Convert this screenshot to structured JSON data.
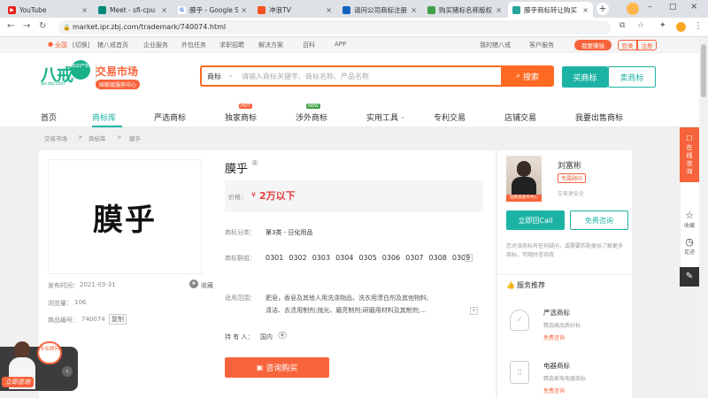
{
  "browser": {
    "tabs": [
      {
        "title": "YouTube",
        "favicon_color": "#e62117",
        "glyph": "▶"
      },
      {
        "title": "Meet - sfi-cpu",
        "favicon_color": "#00897b",
        "glyph": "●"
      },
      {
        "title": "膜乎 - Google Se",
        "favicon_color": "#4285f4",
        "glyph": "G"
      },
      {
        "title": "冲浪TV",
        "favicon_color": "#f4511e",
        "glyph": "●"
      },
      {
        "title": "请问公司商标注册",
        "favicon_color": "#1565c0",
        "glyph": "●"
      },
      {
        "title": "购买猪标名称版权",
        "favicon_color": "#43a047",
        "glyph": "●"
      },
      {
        "title": "膜乎商标转让购买",
        "favicon_color": "#26a69a",
        "glyph": "●"
      }
    ],
    "url": "market.ipr.zbj.com/trademark/740074.html"
  },
  "topnav": {
    "location": "全国",
    "switch": "[切换]",
    "links": [
      "猪八戒首页",
      "企业服务",
      "外包任务",
      "求职招聘",
      "解决方案",
      "百科",
      "APP"
    ],
    "my_zbj": "我的猪八戒",
    "customer_service": "客户服务",
    "earn": "我要赚钱",
    "login": "登录",
    "register": "注册"
  },
  "header": {
    "logo_text": "八戒",
    "logo_sub": "知识产权",
    "logo_domain": "ipr.zbj.com",
    "market_title": "交易市场",
    "market_badge": "国家级服务中心",
    "search_category": "商标",
    "search_placeholder": "请输入商标关键字、商标名称、产品名称",
    "search_button": "搜索",
    "buy_button": "买商标",
    "sell_button": "卖商标"
  },
  "mainnav": {
    "items": [
      "首页",
      "商标库",
      "严选商标",
      "独家商标",
      "涉外商标",
      "实用工具",
      "专利交易",
      "店铺交易",
      "我要出售商标"
    ],
    "hot": "HOT",
    "new": "NEW"
  },
  "breadcrumb": [
    "交易市场",
    "商标库",
    "膜乎"
  ],
  "trademark": {
    "image_text": "膜乎",
    "name": "膜乎",
    "registered_mark": "®",
    "price_label": "价格：",
    "price_symbol": "¥",
    "price_value": "2万以下",
    "category_label": "商标分类：",
    "category_value": "第3类 - 日化用品",
    "group_label": "商标群组：",
    "groups": [
      "0301",
      "0302",
      "0303",
      "0304",
      "0305",
      "0306",
      "0307",
      "0308",
      "0309"
    ],
    "scope_label": "适用范围：",
    "scope_line1": "肥皂，香皂及其他人用洗涤物品，洗衣用漂白剂及其他物料;",
    "scope_line2": "清洁、去渍用制剂;抛光、磨亮制剂;研磨用材料及其制剂;...",
    "owner_label": "持 有 人：",
    "owner_value": "国内",
    "publish_label": "发布时间：",
    "publish_value": "2021-03-31",
    "favorite": "收藏",
    "views_label": "浏览量：",
    "views_value": "106",
    "code_label": "商品编号：",
    "code_value": "740074",
    "copy": "复制",
    "inquire_button": "咨询购买"
  },
  "agent": {
    "name": "刘富彬",
    "title": "专属顾问",
    "photo_caption": "国家级服务中心",
    "subtitle": "交易更安全",
    "call_button": "立即回Call",
    "consult_button": "免费咨询",
    "note": "您对该商标有任何疑问，或需要匹配类似了解更多商标，可随时咨询我",
    "services_title": "服务推荐",
    "services": [
      {
        "name": "严选商标",
        "desc": "精选高品质好标",
        "action": "免费咨询"
      },
      {
        "name": "电器商标",
        "desc": "精选家电电器商标",
        "action": "免费咨询"
      }
    ]
  },
  "right_tools": {
    "online_consult": "在线咨询",
    "favorite": "收藏",
    "history": "足迹",
    "feedback": "反馈"
  },
  "float_banner": {
    "bubble": "专业顾问",
    "label": "立即咨询"
  },
  "colors": {
    "brand_orange": "#f7633b",
    "brand_teal": "#1db3a4",
    "search_orange": "#ff6a23"
  }
}
